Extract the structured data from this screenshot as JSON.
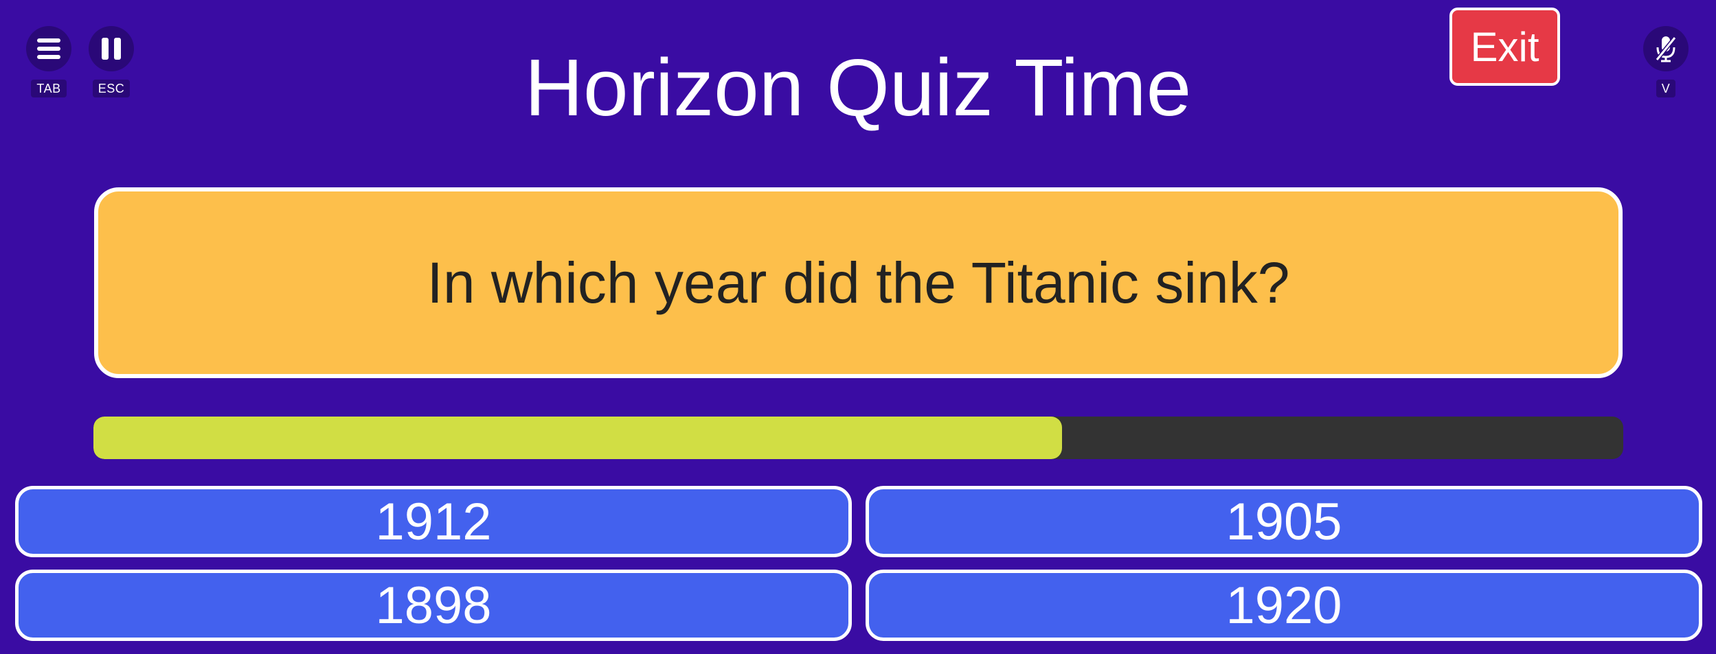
{
  "header": {
    "title": "Horizon Quiz Time",
    "exit_label": "Exit"
  },
  "controls": {
    "menu": {
      "icon": "menu-icon",
      "key": "TAB"
    },
    "pause": {
      "icon": "pause-icon",
      "key": "ESC"
    },
    "mic": {
      "icon": "mic-muted-icon",
      "key": "V"
    }
  },
  "question": {
    "text": "In which year did the Titanic sink?"
  },
  "timer": {
    "remaining_fraction": 0.633
  },
  "answers": [
    {
      "label": "1912"
    },
    {
      "label": "1905"
    },
    {
      "label": "1898"
    },
    {
      "label": "1920"
    }
  ],
  "colors": {
    "background": "#3a0ca3",
    "question_card": "#fdbf4b",
    "answer_button": "#4361ee",
    "exit_button": "#e63946",
    "timer_fill": "#d1de44",
    "timer_track": "#333333"
  }
}
